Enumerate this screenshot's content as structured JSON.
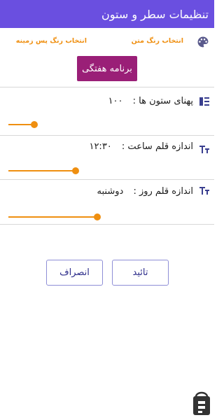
{
  "appbar": {
    "title": "تنظیمات سطر و ستون"
  },
  "colors": {
    "text_color_label": "انتخاب رنگ متن",
    "background_color_label": "انتخاب رنگ پس زمینه",
    "accent": "#ef8f10",
    "appbar_bg": "#6a4fe0",
    "weekly_bg": "#9a1f77"
  },
  "weekly_button": {
    "label": "برنامه هفتگی"
  },
  "settings": {
    "column_width": {
      "label": "پهنای ستون ها :",
      "value": "۱۰۰",
      "icon": "view-columns-icon",
      "level": 0.13
    },
    "time_font": {
      "label": "اندازه قلم ساعت :",
      "value": "۱۲:۳۰",
      "icon": "text-size-icon",
      "level": 0.34
    },
    "day_font": {
      "label": "اندازه قلم روز :",
      "value": "دوشنبه",
      "icon": "text-size-icon",
      "level": 0.45
    }
  },
  "actions": {
    "confirm": "تائید",
    "cancel": "انصراف"
  },
  "store_badge": {
    "icon": "bazaar-logo-icon"
  }
}
